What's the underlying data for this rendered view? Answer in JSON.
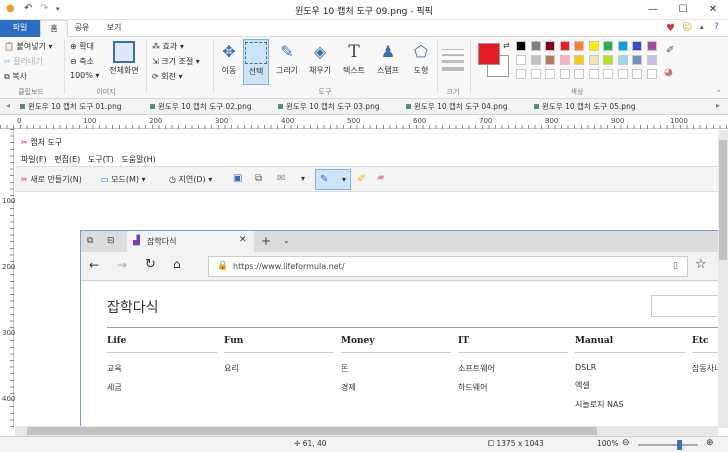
{
  "window": {
    "title": "윈도우 10 캡처 도구 09.png - 픽픽",
    "min_label": "—",
    "max_label": "☐",
    "close_label": "✕"
  },
  "ribbon_tabs": [
    "파일",
    "홈",
    "공유",
    "보기"
  ],
  "clipboard": {
    "paste": "붙여넣기",
    "cut": "잘라내기",
    "copy": "복사",
    "label": "클립보드"
  },
  "image_group": {
    "zoom_in": "확대",
    "zoom_out": "축소",
    "zoom": "100%",
    "fullscreen": "전체화면",
    "label": "이미지"
  },
  "effects": {
    "effect": "효과",
    "resize": "크기 조절",
    "rotate": "회전"
  },
  "tools": {
    "move": "이동",
    "select": "선택",
    "draw": "그리기",
    "fill": "채우기",
    "text": "텍스트",
    "stamp": "스탬프",
    "shape": "도형",
    "label": "도구"
  },
  "size_label": "크기",
  "color_label": "색상",
  "colors": {
    "primary": "#e51c23",
    "palette_row1": [
      "#000000",
      "#7f7f7f",
      "#880015",
      "#ed1c24",
      "#ff7f27",
      "#fff200",
      "#22b14c",
      "#00a2e8",
      "#3f48cc",
      "#a349a4"
    ],
    "palette_row2": [
      "#ffffff",
      "#c3c3c3",
      "#b97a57",
      "#ffaec9",
      "#ffc90e",
      "#efe4b0",
      "#b5e61d",
      "#99d9ea",
      "#7092be",
      "#c8bfe7"
    ]
  },
  "doc_tabs": [
    "윈도우 10 캡처 도구 01.png",
    "윈도우 10 캡처 도구 02.png",
    "윈도우 10 캡처 도구 03.png",
    "윈도우 10 캡처 도구 04.png",
    "윈도우 10 캡처 도구 05.png"
  ],
  "ruler_h": [
    "0",
    "100",
    "200",
    "300",
    "400",
    "500",
    "600",
    "700",
    "800",
    "900",
    "1000"
  ],
  "ruler_v": [
    "100",
    "200",
    "300",
    "400"
  ],
  "snip": {
    "title": "캡처 도구",
    "menu": [
      "파일(F)",
      "편집(E)",
      "도구(T)",
      "도움말(H)"
    ],
    "new": "새로 만들기(N)",
    "mode": "모드(M)",
    "delay": "지연(D)"
  },
  "browser": {
    "tab_title": "잡학다식",
    "url": "https://www.lifeformula.net/",
    "site_title": "잡학다식",
    "columns": [
      {
        "head": "Life",
        "items": [
          "교육",
          "세금"
        ]
      },
      {
        "head": "Fun",
        "items": [
          "요리"
        ]
      },
      {
        "head": "Money",
        "items": [
          "돈",
          "경제"
        ]
      },
      {
        "head": "IT",
        "items": [
          "소프트웨어",
          "하드웨어"
        ]
      },
      {
        "head": "Manual",
        "items": [
          "DSLR",
          "엑셀",
          "시놀로지 NAS"
        ]
      },
      {
        "head": "Etc",
        "items": [
          "잡동사니"
        ]
      }
    ]
  },
  "status": {
    "cursor": "61, 40",
    "image_size": "1375 x 1043",
    "zoom": "100%"
  }
}
